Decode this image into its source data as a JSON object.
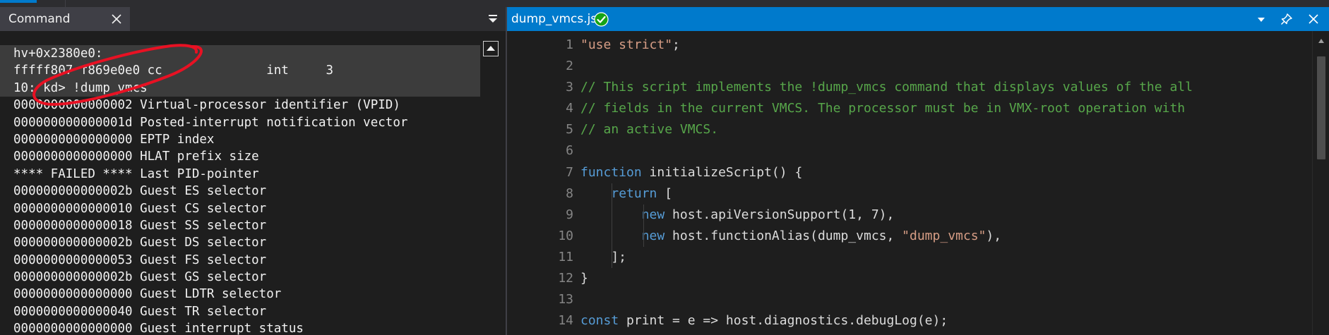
{
  "command_pane": {
    "tab_label": "Command",
    "output_lines": [
      "hv+0x2380e0:",
      "fffff807 f869e0e0 cc              int     3",
      "10: kd> !dump_vmcs",
      "0000000000000002 Virtual-processor identifier (VPID)",
      "000000000000001d Posted-interrupt notification vector",
      "0000000000000000 EPTP index",
      "0000000000000000 HLAT prefix size",
      "**** FAILED **** Last PID-pointer",
      "000000000000002b Guest ES selector",
      "0000000000000010 Guest CS selector",
      "0000000000000018 Guest SS selector",
      "000000000000002b Guest DS selector",
      "0000000000000053 Guest FS selector",
      "000000000000002b Guest GS selector",
      "0000000000000000 Guest LDTR selector",
      "0000000000000040 Guest TR selector",
      "0000000000000000 Guest interrupt status"
    ]
  },
  "editor": {
    "file_title": "dump_vmcs.js",
    "line_numbers": [
      "1",
      "2",
      "3",
      "4",
      "5",
      "6",
      "7",
      "8",
      "9",
      "10",
      "11",
      "12",
      "13",
      "14"
    ],
    "lines": [
      [
        {
          "t": "str",
          "v": "\"use strict\""
        },
        {
          "t": "txt",
          "v": ";"
        }
      ],
      [],
      [
        {
          "t": "com",
          "v": "// This script implements the !dump_vmcs command that displays values of the all"
        }
      ],
      [
        {
          "t": "com",
          "v": "// fields in the current VMCS. The processor must be in VMX-root operation with"
        }
      ],
      [
        {
          "t": "com",
          "v": "// an active VMCS."
        }
      ],
      [],
      [
        {
          "t": "kw",
          "v": "function"
        },
        {
          "t": "txt",
          "v": " initializeScript() {"
        }
      ],
      [
        {
          "t": "txt",
          "v": "    "
        },
        {
          "t": "kw",
          "v": "return"
        },
        {
          "t": "txt",
          "v": " ["
        }
      ],
      [
        {
          "t": "txt",
          "v": "        "
        },
        {
          "t": "kw",
          "v": "new"
        },
        {
          "t": "txt",
          "v": " host.apiVersionSupport(1, 7),"
        }
      ],
      [
        {
          "t": "txt",
          "v": "        "
        },
        {
          "t": "kw",
          "v": "new"
        },
        {
          "t": "txt",
          "v": " host.functionAlias(dump_vmcs, "
        },
        {
          "t": "str",
          "v": "\"dump_vmcs\""
        },
        {
          "t": "txt",
          "v": "),"
        }
      ],
      [
        {
          "t": "txt",
          "v": "    ];"
        }
      ],
      [
        {
          "t": "txt",
          "v": "}"
        }
      ],
      [],
      [
        {
          "t": "kw",
          "v": "const"
        },
        {
          "t": "txt",
          "v": " print = e => host.diagnostics.debugLog(e);"
        }
      ]
    ]
  },
  "colors": {
    "accent": "#007acc",
    "annotation": "#e81123",
    "status_ok": "#16a316",
    "string": "#d69d85",
    "comment": "#57a64a",
    "keyword": "#569cd6"
  },
  "icons": {
    "tab_close": "close-icon",
    "pane_menu": "menu-dropdown-icon",
    "status": "checkmark-circle-icon",
    "pin": "pin-icon",
    "scroll_up": "scroll-up-arrow-icon"
  }
}
